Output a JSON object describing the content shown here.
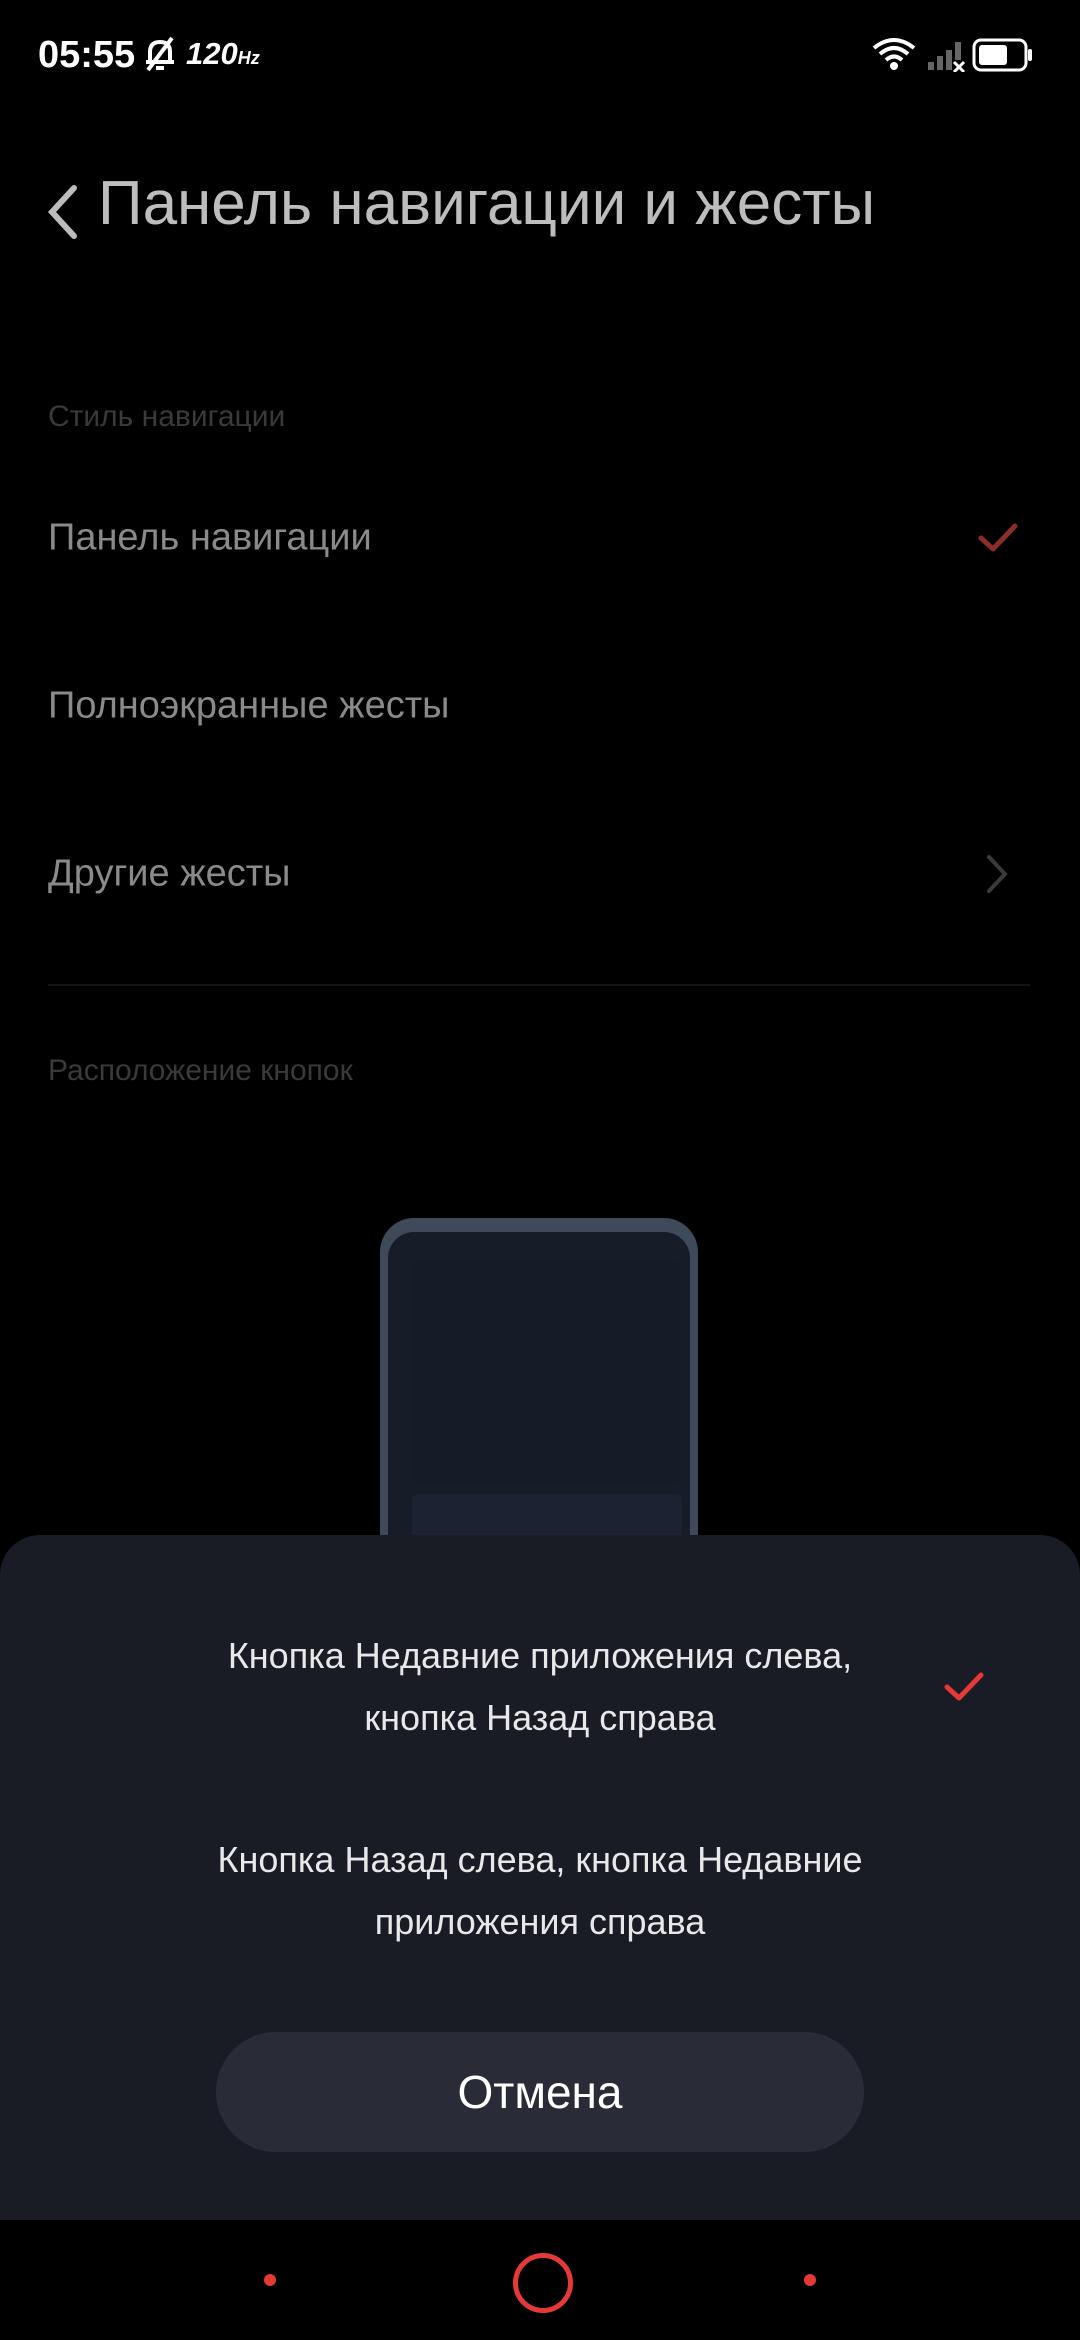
{
  "status_bar": {
    "time": "05:55",
    "refresh_rate": "120",
    "refresh_unit": "Hz"
  },
  "header": {
    "title": "Панель навигации и жесты"
  },
  "nav_style": {
    "section_label": "Стиль навигации",
    "options": [
      {
        "label": "Панель навигации",
        "selected": true
      },
      {
        "label": "Полноэкранные жесты",
        "selected": false
      },
      {
        "label": "Другие жесты",
        "has_chevron": true
      }
    ]
  },
  "buttons_layout": {
    "section_label": "Расположение кнопок"
  },
  "sheet": {
    "options": [
      {
        "line1": "Кнопка Недавние приложения слева,",
        "line2": "кнопка Назад справа",
        "selected": true
      },
      {
        "line1": "Кнопка Назад слева, кнопка Недавние",
        "line2": "приложения справа",
        "selected": false
      }
    ],
    "cancel_label": "Отмена"
  },
  "colors": {
    "accent": "#e53935",
    "background": "#000000",
    "sheet_background": "#191c24",
    "cancel_button": "#292c36"
  },
  "icons": [
    "bell-off-icon",
    "wifi-icon",
    "signal-icon",
    "battery-icon",
    "back-arrow-icon",
    "checkmark-icon",
    "chevron-right-icon",
    "home-circle-icon",
    "recent-dot-icon",
    "back-dot-icon"
  ]
}
